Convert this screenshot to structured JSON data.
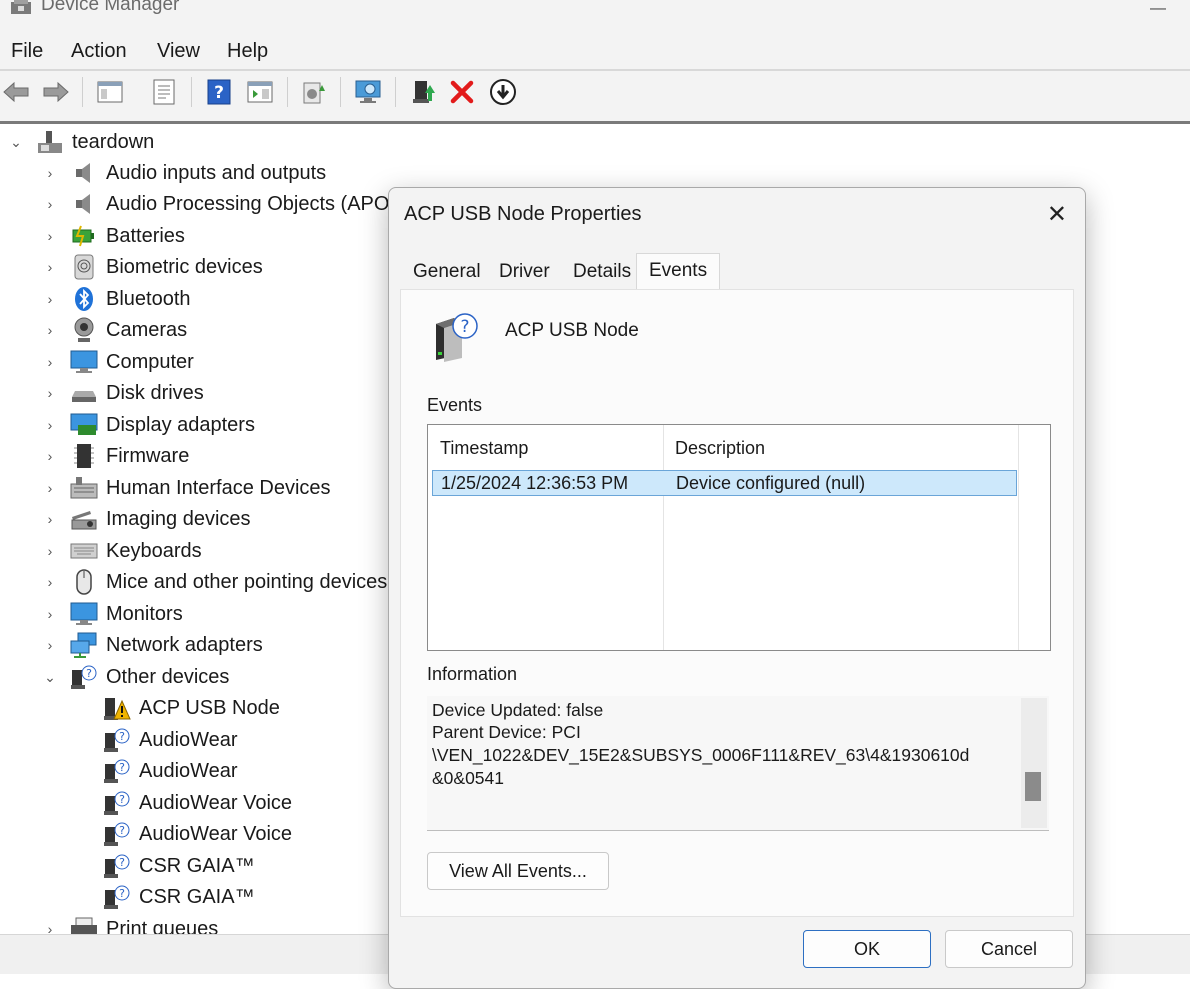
{
  "window": {
    "title": "Device Manager"
  },
  "menu": [
    "File",
    "Action",
    "View",
    "Help"
  ],
  "toolbar": {
    "buttons": [
      "back-icon",
      "forward-icon",
      "show-hide-console-tree-icon",
      "properties-icon",
      "help-icon",
      "show-action-pane-icon",
      "update-driver-icon",
      "scan-hardware-icon",
      "enable-device-icon",
      "uninstall-icon",
      "download-icon"
    ]
  },
  "tree": {
    "root": "teardown",
    "categories": [
      "Audio inputs and outputs",
      "Audio Processing Objects (APOs)",
      "Batteries",
      "Biometric devices",
      "Bluetooth",
      "Cameras",
      "Computer",
      "Disk drives",
      "Display adapters",
      "Firmware",
      "Human Interface Devices",
      "Imaging devices",
      "Keyboards",
      "Mice and other pointing devices",
      "Monitors",
      "Network adapters",
      "Other devices"
    ],
    "other_devices": [
      "ACP USB Node",
      "AudioWear",
      "AudioWear",
      "AudioWear Voice",
      "AudioWear Voice",
      "CSR GAIA™",
      "CSR GAIA™"
    ],
    "next_category": "Print queues"
  },
  "dialog": {
    "title": "ACP USB Node Properties",
    "tabs": [
      "General",
      "Driver",
      "Details",
      "Events"
    ],
    "active_tab": "Events",
    "device_name": "ACP USB Node",
    "events_label": "Events",
    "columns": [
      "Timestamp",
      "Description"
    ],
    "events": [
      {
        "timestamp": "1/25/2024 12:36:53 PM",
        "description": "Device configured (null)"
      }
    ],
    "information_label": "Information",
    "information_lines": [
      "Device Updated: false",
      "Parent Device: PCI",
      "\\VEN_1022&DEV_15E2&SUBSYS_0006F111&REV_63\\4&1930610d",
      "&0&0541"
    ],
    "view_all_label": "View All Events...",
    "ok_label": "OK",
    "cancel_label": "Cancel"
  }
}
